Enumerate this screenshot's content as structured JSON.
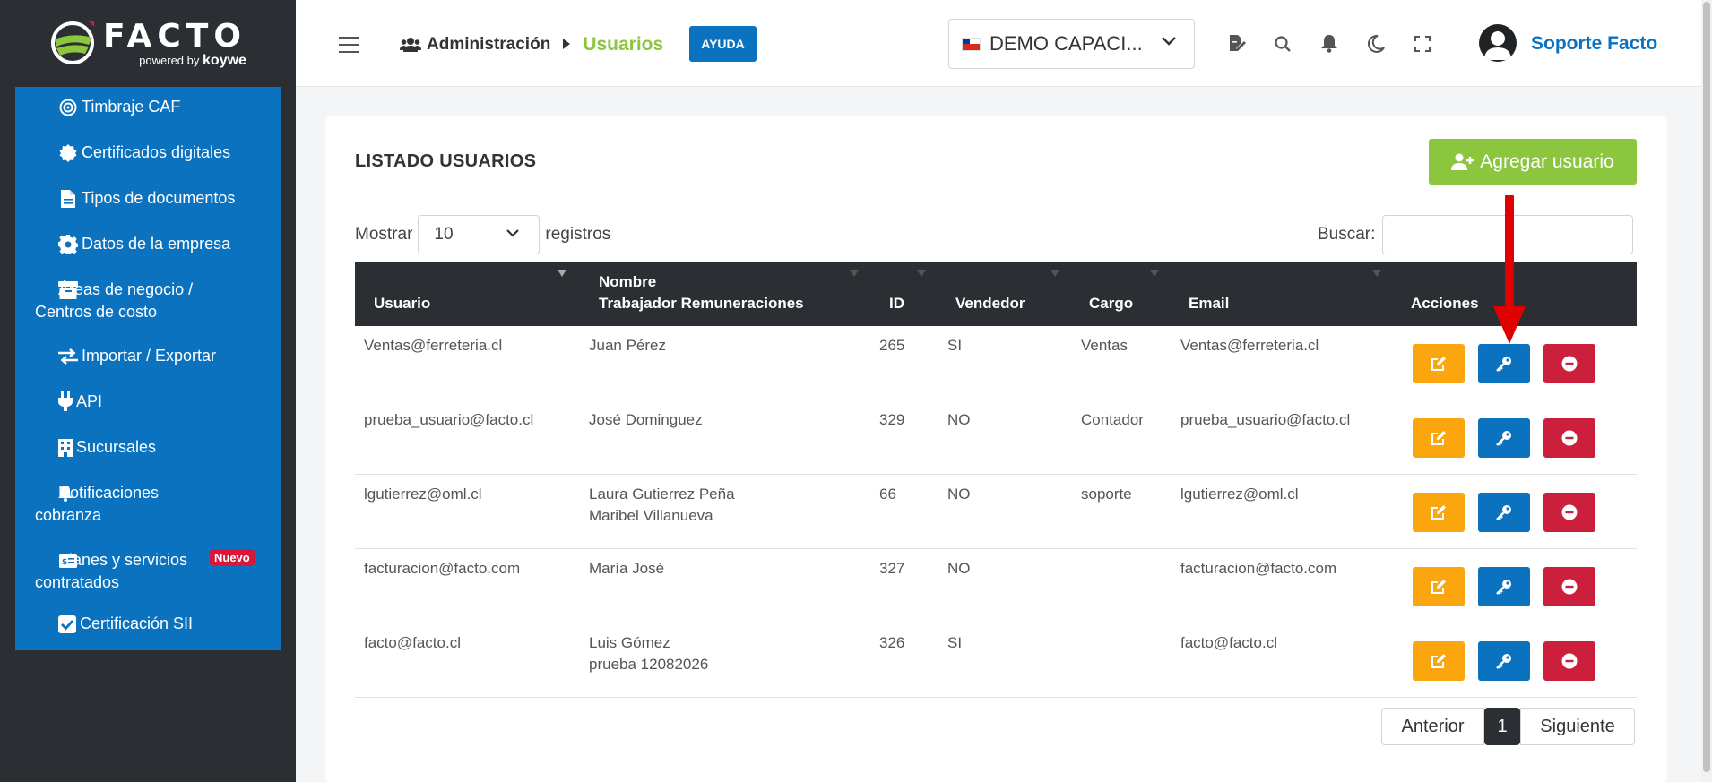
{
  "brand": {
    "name": "FACTO",
    "powered": "powered",
    "by": "by",
    "partner": "koywe",
    "logo_color": "#8cc63f"
  },
  "sidebar": {
    "items": [
      {
        "label": "Timbraje CAF",
        "icon": "target-icon"
      },
      {
        "label": "Certificados digitales",
        "icon": "certificate-icon"
      },
      {
        "label": "Tipos de documentos",
        "icon": "document-icon"
      },
      {
        "label": "Datos de la empresa",
        "icon": "gear-icon"
      },
      {
        "label": "Áreas de negocio / Centros de costo",
        "icon": "archive-icon"
      },
      {
        "label": "Importar / Exportar",
        "icon": "exchange-icon"
      },
      {
        "label": "API",
        "icon": "plug-icon"
      },
      {
        "label": "Sucursales",
        "icon": "building-icon"
      },
      {
        "label": "Notificaciones cobranza",
        "icon": "bell-icon"
      },
      {
        "label": "Planes y servicios contratados",
        "icon": "money-bill-icon",
        "badge": "Nuevo"
      },
      {
        "label": "Certificación SII",
        "icon": "check-square-icon"
      }
    ]
  },
  "header": {
    "breadcrumb_parent": "Administración",
    "breadcrumb_current": "Usuarios",
    "help_label": "AYUDA",
    "company": "DEMO CAPACI...",
    "user_name": "Soporte Facto"
  },
  "page": {
    "title": "LISTADO USUARIOS",
    "add_button": "Agregar usuario",
    "show_label": "Mostrar",
    "show_value": "10",
    "records_label": "registros",
    "search_label": "Buscar:",
    "search_value": ""
  },
  "table": {
    "columns": [
      "Usuario",
      "Nombre",
      "Trabajador Remuneraciones",
      "ID",
      "Vendedor",
      "Cargo",
      "Email",
      "Acciones"
    ],
    "rows": [
      {
        "usuario": "Ventas@ferreteria.cl",
        "nombre": "Juan Pérez",
        "trabajador": "",
        "id": "265",
        "vendedor": "SI",
        "cargo": "Ventas",
        "email": "Ventas@ferreteria.cl"
      },
      {
        "usuario": "prueba_usuario@facto.cl",
        "nombre": "José Dominguez",
        "trabajador": "",
        "id": "329",
        "vendedor": "NO",
        "cargo": "Contador",
        "email": "prueba_usuario@facto.cl"
      },
      {
        "usuario": "lgutierrez@oml.cl",
        "nombre": "Laura Gutierrez Peña",
        "trabajador": "Maribel Villanueva",
        "id": "66",
        "vendedor": "NO",
        "cargo": "soporte",
        "email": "lgutierrez@oml.cl"
      },
      {
        "usuario": "facturacion@facto.com",
        "nombre": "María José",
        "trabajador": "",
        "id": "327",
        "vendedor": "NO",
        "cargo": "",
        "email": "facturacion@facto.com"
      },
      {
        "usuario": "facto@facto.cl",
        "nombre": "Luis Gómez",
        "trabajador": "prueba 12082026",
        "id": "326",
        "vendedor": "SI",
        "cargo": "",
        "email": "facto@facto.cl"
      }
    ]
  },
  "pagination": {
    "prev": "Anterior",
    "current": "1",
    "next": "Siguiente"
  },
  "colors": {
    "primary": "#0b72c0",
    "success": "#8cc63f",
    "warning": "#fba50f",
    "danger": "#cc1f3c",
    "dark": "#2b2f33",
    "badge": "#d9173a",
    "annotation": "#e00000"
  }
}
